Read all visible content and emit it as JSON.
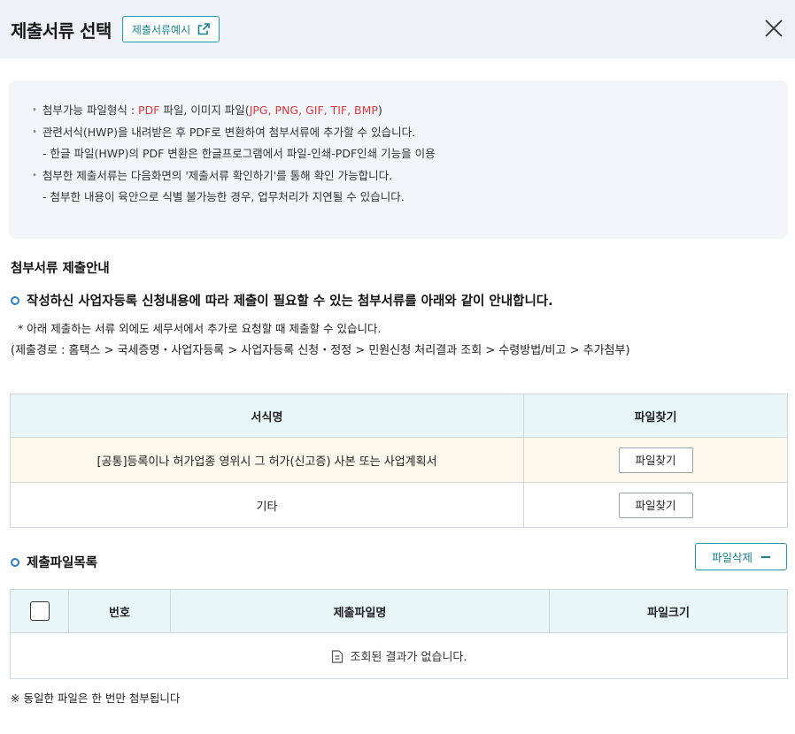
{
  "header": {
    "title": "제출서류 선택",
    "sample_button": "제출서류예시"
  },
  "notice": {
    "line1_prefix": "첨부가능 파일형식 : ",
    "line1_pdf": "PDF",
    "line1_mid": " 파일, 이미지 파일(",
    "line1_formats": "JPG, PNG, GIF, TIF, BMP",
    "line1_suffix": ")",
    "line2": "관련서식(HWP)을 내려받은 후 PDF로 변환하여 첨부서류에 추가할 수 있습니다.",
    "line3": "- 한글 파일(HWP)의 PDF 변환은 한글프로그램에서 파일-인쇄-PDF인쇄 기능을 이용",
    "line4": "첨부한 제출서류는 다음화면의 '제출서류 확인하기'를 통해 확인 가능합니다.",
    "line5": "- 첨부한 내용이 육안으로 식별 불가능한 경우, 업무처리가 지연될 수 있습니다."
  },
  "guide": {
    "section_title": "첨부서류 제출안내",
    "main_text": "작성하신 사업자등록 신청내용에 따라 제출이 필요할 수 있는 첨부서류를 아래와 같이 안내합니다.",
    "note": "* 아래 제출하는 서류 외에도 세무서에서 추가로 요청할 때 제출할 수 있습니다.",
    "path": "(제출경로 : 홈택스 > 국세증명・사업자등록 > 사업자등록 신청・정정 > 민원신청 처리결과 조회 > 수령방법/비고 > 추가첨부)"
  },
  "forms_table": {
    "col_name": "서식명",
    "col_find": "파일찾기",
    "rows": [
      {
        "name": "[공통]등록이나 허가업종 영위시 그 허가(신고증) 사본 또는 사업계획서",
        "button": "파일찾기"
      },
      {
        "name": "기타",
        "button": "파일찾기"
      }
    ]
  },
  "files": {
    "title": "제출파일목록",
    "delete_button": "파일삭제",
    "col_number": "번호",
    "col_filename": "제출파일명",
    "col_size": "파일크기",
    "empty_message": "조회된 결과가 없습니다."
  },
  "footnote": "※ 동일한 파일은 한 번만 첨부됩니다",
  "colors": {
    "accent": "#1d9da9",
    "highlight_red": "#e0393e",
    "table_header_bg": "#e8f6f7",
    "highlight_row_bg": "#fcf8ec",
    "header_bg": "#eef1f7"
  }
}
